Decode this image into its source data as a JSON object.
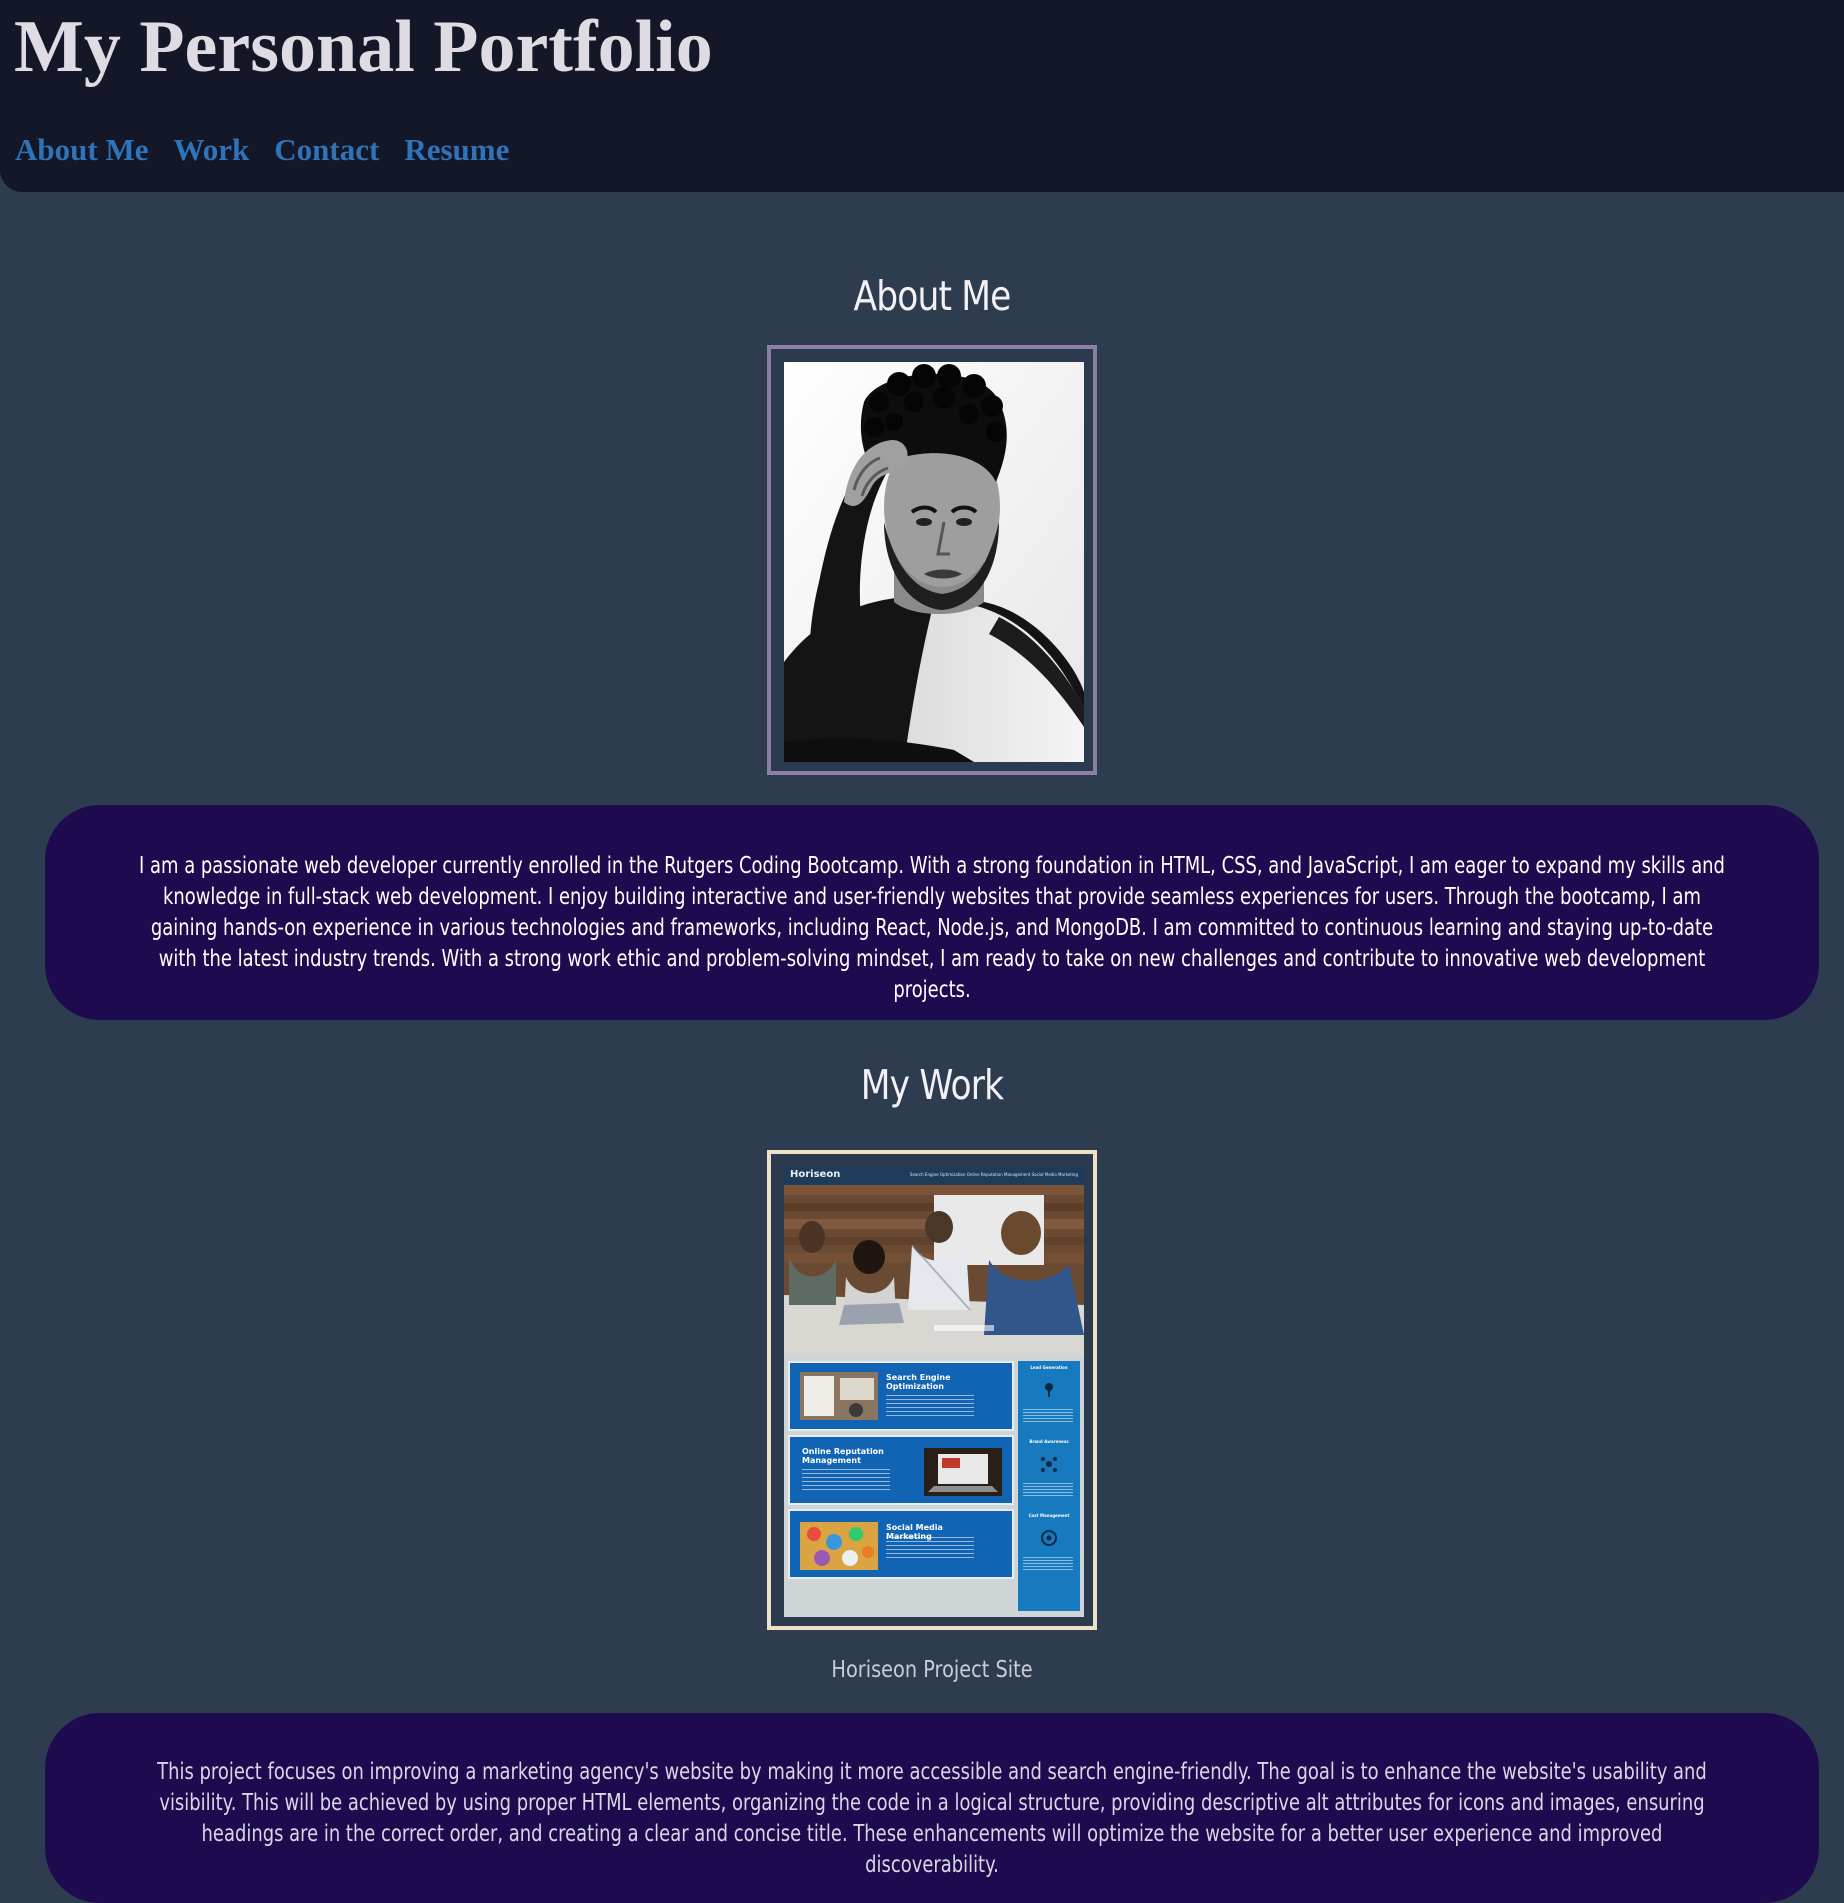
{
  "header": {
    "title": "My Personal Portfolio",
    "nav": [
      "About Me",
      "Work",
      "Contact",
      "Resume"
    ]
  },
  "about": {
    "heading": "About Me",
    "bio": "I am a passionate web developer currently enrolled in the Rutgers Coding Bootcamp. With a strong foundation in HTML, CSS, and JavaScript, I am eager to expand my skills and knowledge in full-stack web development. I enjoy building interactive and user-friendly websites that provide seamless experiences for users. Through the bootcamp, I am gaining hands-on experience in various technologies and frameworks, including React, Node.js, and MongoDB. I am committed to continuous learning and staying up-to-date with the latest industry trends. With a strong work ethic and problem-solving mindset, I am ready to take on new challenges and contribute to innovative web development projects."
  },
  "work": {
    "heading": "My Work",
    "project": {
      "caption": "Horiseon Project Site",
      "description": "This project focuses on improving a marketing agency's website by making it more accessible and search engine-friendly. The goal is to enhance the website's usability and visibility. This will be achieved by using proper HTML elements, organizing the code in a logical structure, providing descriptive alt attributes for icons and images, ensuring headings are in the correct order, and creating a clear and concise title. These enhancements will optimize the website for a better user experience and improved discoverability.",
      "screenshot": {
        "brand": "Horiseon",
        "nav": "Search Engine Optimization     Online Reputation Management     Social Media Marketing",
        "cards": [
          "Search Engine Optimization",
          "Online Reputation Management",
          "Social Media Marketing"
        ],
        "aside": [
          "Lead Generation",
          "Brand Awareness",
          "Cost Management"
        ]
      }
    }
  },
  "colors": {
    "page_background": "#2e3c50",
    "header_background": "#131727",
    "nav_link": "#2f73b8",
    "panel_background": "#1e0a4e",
    "profile_frame": "#8c7fa6",
    "project_frame": "#ede1c8"
  }
}
